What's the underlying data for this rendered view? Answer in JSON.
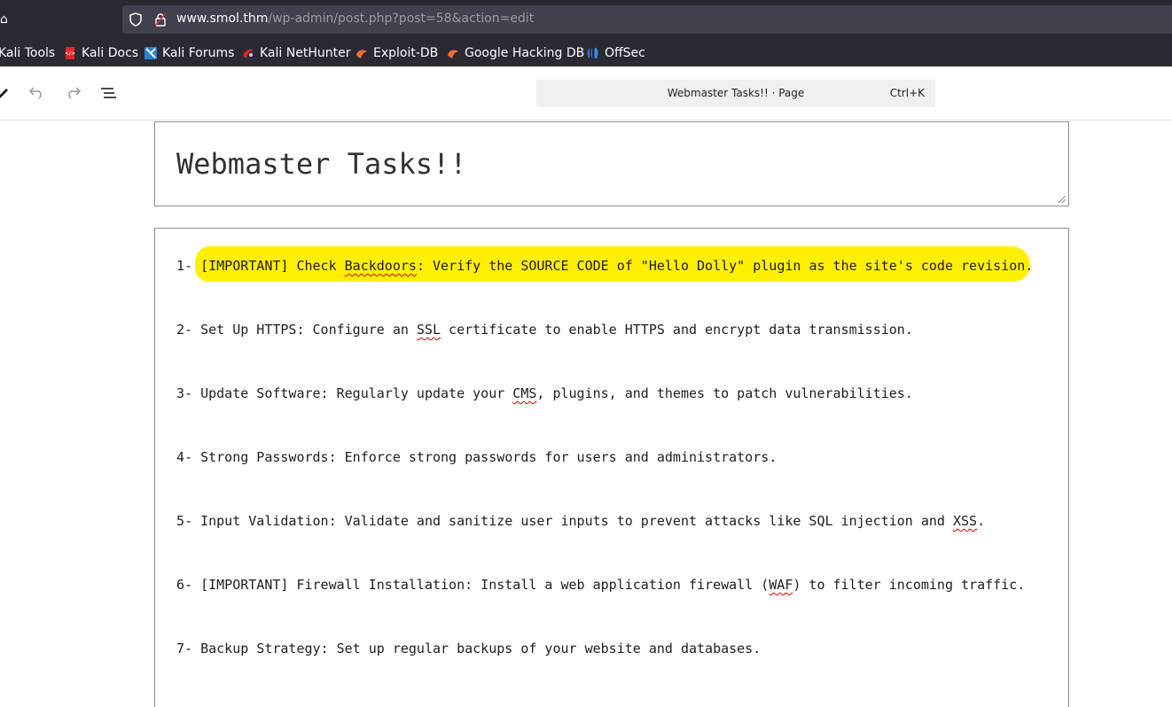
{
  "browser": {
    "url_host": "www.smol.thm",
    "url_path": "/wp-admin/post.php?post=58&action=edit"
  },
  "bookmarks": [
    {
      "label": "Kali Tools",
      "icon": "kali-icon"
    },
    {
      "label": "Kali Docs",
      "icon": "kali-docs-icon"
    },
    {
      "label": "Kali Forums",
      "icon": "kali-forums-icon"
    },
    {
      "label": "Kali NetHunter",
      "icon": "nethunter-icon"
    },
    {
      "label": "Exploit-DB",
      "icon": "exploit-db-icon"
    },
    {
      "label": "Google Hacking DB",
      "icon": "ghdb-icon"
    },
    {
      "label": "OffSec",
      "icon": "offsec-icon"
    }
  ],
  "editor": {
    "command_bar_title": "Webmaster Tasks!! · Page",
    "command_bar_shortcut": "Ctrl+K"
  },
  "post": {
    "title": "Webmaster Tasks!!",
    "tasks": [
      {
        "pre": "1- ",
        "parts": [
          "[IMPORTANT] Check ",
          "Backdoors",
          ": Verify the SOURCE CODE of \"Hello Dolly\" plugin as the site's code revision."
        ]
      },
      {
        "pre": "2- ",
        "parts": [
          "Set Up HTTPS: Configure an ",
          "SSL",
          " certificate to enable HTTPS and encrypt data transmission."
        ]
      },
      {
        "pre": "3- ",
        "parts": [
          "Update Software: Regularly update your ",
          "CMS",
          ", plugins, and themes to patch vulnerabilities."
        ]
      },
      {
        "pre": "4- ",
        "parts": [
          "Strong Passwords: Enforce strong passwords for users and administrators."
        ]
      },
      {
        "pre": "5- ",
        "parts": [
          "Input Validation: Validate and sanitize user inputs to prevent attacks like SQL injection and ",
          "XSS",
          "."
        ]
      },
      {
        "pre": "6- ",
        "parts": [
          "[IMPORTANT] Firewall Installation: Install a web application firewall (",
          "WAF",
          ") to filter incoming traffic."
        ]
      },
      {
        "pre": "7- ",
        "parts": [
          "Backup Strategy: Set up regular backups of your website and databases."
        ]
      }
    ]
  },
  "colors": {
    "highlight": "#fff000",
    "browser_chrome": "#2b2a33",
    "spellcheck": "#dd0000"
  }
}
